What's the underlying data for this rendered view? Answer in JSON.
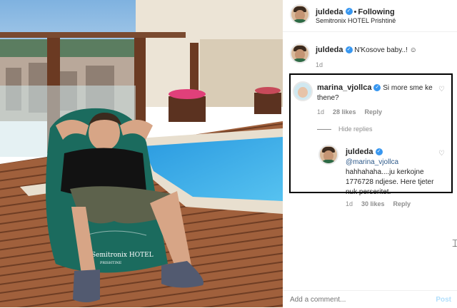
{
  "post": {
    "username": "juldeda",
    "follow_state": "Following",
    "location": "Semitronix HOTEL Prishtinë",
    "more_icon": "ellipsis-icon"
  },
  "caption": {
    "username": "juldeda",
    "text": "N'Kosove baby..! ☺",
    "time": "1d"
  },
  "comment": {
    "username": "marina_vjollca",
    "text": "Si more sme ke thene?",
    "time": "1d",
    "likes": "28 likes",
    "reply_label": "Reply"
  },
  "hide_replies": "Hide replies",
  "reply": {
    "username": "juldeda",
    "mention": "@marina_vjollca",
    "text": "hahhahaha....ju kerkojne 1776728 ndjese. Here tjeter nuk perseritet.",
    "time": "1d",
    "likes": "30 likes",
    "reply_label": "Reply"
  },
  "footer": {
    "placeholder": "Add a comment...",
    "post_label": "Post"
  },
  "photo": {
    "beanbag_brand": "Semitronix HOTEL",
    "beanbag_sub": "PRISHTINE"
  },
  "colors": {
    "link_blue": "#3897f0",
    "highlight_border": "#000000",
    "pool": "#3aa7e0",
    "deck": "#9b5b3a"
  }
}
